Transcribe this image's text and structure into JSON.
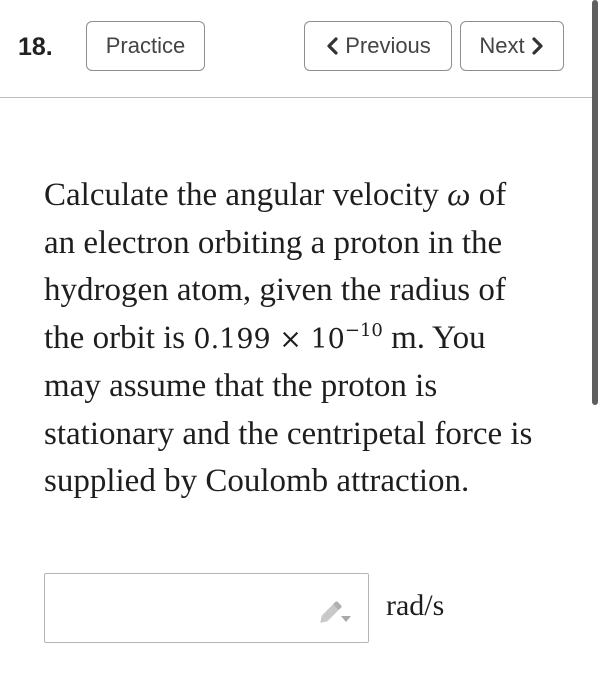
{
  "header": {
    "question_number": "18.",
    "practice_label": "Practice",
    "previous_label": "Previous",
    "next_label": "Next"
  },
  "question": {
    "text_part1": "Calculate the angular velocity ",
    "omega_symbol": "ω",
    "text_part2": " of an electron orbiting a proton in the hydrogen atom, given the radius of the orbit is ",
    "radius_value": "0.199 × 10",
    "radius_exponent": "−10",
    "radius_unit": " m",
    "text_part3": ". You may assume that the proton is stationary and the centripetal force is supplied by Coulomb attraction."
  },
  "answer": {
    "value": "",
    "unit": "rad/s"
  },
  "icons": {
    "previous": "chevron-left-icon",
    "next": "chevron-right-icon",
    "edit": "pencil-icon"
  },
  "colors": {
    "button_border": "#8e8e8e",
    "divider": "#bdbdbd",
    "scrollbar": "#5f5f5f"
  }
}
